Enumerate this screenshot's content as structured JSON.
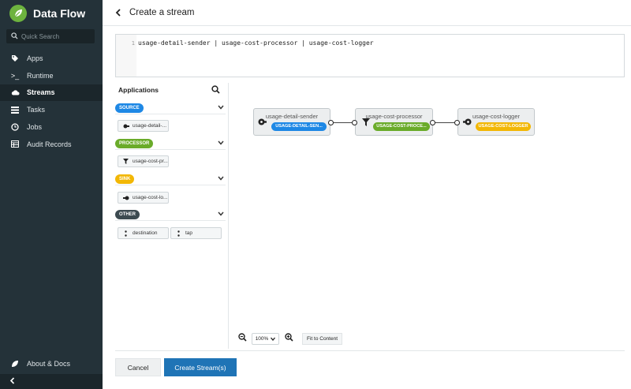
{
  "sidebar": {
    "brand": "Data Flow",
    "search_placeholder": "Quick Search",
    "items": [
      {
        "label": "Apps",
        "icon": "tag-icon"
      },
      {
        "label": "Runtime",
        "icon": "terminal-icon"
      },
      {
        "label": "Streams",
        "icon": "cloud-icon",
        "active": true
      },
      {
        "label": "Tasks",
        "icon": "list-icon"
      },
      {
        "label": "Jobs",
        "icon": "clock-icon"
      },
      {
        "label": "Audit Records",
        "icon": "table-icon"
      }
    ],
    "about": "About & Docs"
  },
  "header": {
    "title": "Create a stream"
  },
  "editor": {
    "line_number": "1",
    "dsl": "usage-detail-sender | usage-cost-processor | usage-cost-logger"
  },
  "palette": {
    "title": "Applications",
    "groups": [
      {
        "badge": "SOURCE",
        "color": "#1e88e5",
        "apps": [
          "usage-detail-..."
        ]
      },
      {
        "badge": "PROCESSOR",
        "color": "#6aab2a",
        "apps": [
          "usage-cost-pr..."
        ]
      },
      {
        "badge": "SINK",
        "color": "#f2b705",
        "apps": [
          "usage-cost-lo..."
        ]
      },
      {
        "badge": "OTHER",
        "color": "#3c4a50",
        "apps": [
          "destination",
          "tap"
        ]
      }
    ]
  },
  "flow": {
    "nodes": [
      {
        "name": "usage-detail-sender",
        "tag": "USAGE-DETAIL-SEN...",
        "color": "#1e88e5"
      },
      {
        "name": "usage-cost-processor",
        "tag": "USAGE-COST-PROCE...",
        "color": "#6aab2a"
      },
      {
        "name": "usage-cost-logger",
        "tag": "USAGE-COST-LOGGER",
        "color": "#f2b705"
      }
    ]
  },
  "zoom": {
    "level": "100%",
    "fit_label": "Fit to Content"
  },
  "footer": {
    "cancel_label": "Cancel",
    "create_label": "Create Stream(s)"
  }
}
